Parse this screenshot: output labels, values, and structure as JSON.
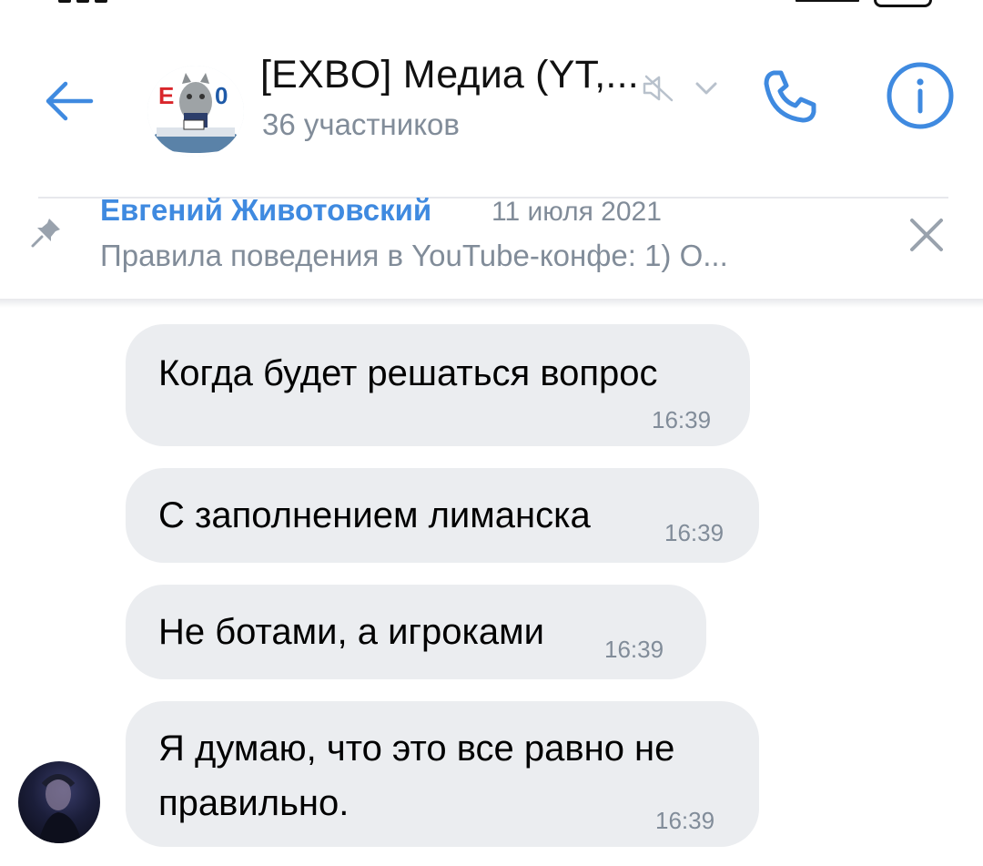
{
  "chat": {
    "title": "[EXBO] Медиа (YT,...",
    "members": "36 участников",
    "avatar_logo_text": "EXBO"
  },
  "pinned": {
    "author": "Евгений Животовский",
    "date": "11 июля 2021",
    "text": "Правила поведения в YouTube-конфе:  1) О..."
  },
  "messages": [
    {
      "text": "Когда будет решаться вопрос",
      "time": "16:39"
    },
    {
      "text": "С заполнением лиманска",
      "time": "16:39"
    },
    {
      "text": "Не ботами, а игроками",
      "time": "16:39"
    },
    {
      "text_line1": "Я думаю, что это все равно не",
      "text_line2": "правильно.",
      "time": "16:39"
    }
  ],
  "icons": {
    "back": "arrow-left-icon",
    "mute": "muted-speaker-icon",
    "dropdown": "chevron-down-icon",
    "call": "phone-icon",
    "info": "info-icon",
    "pin": "pin-icon",
    "close": "close-icon"
  },
  "colors": {
    "accent": "#3f8ae0",
    "secondary_text": "#818c99",
    "bubble": "#ebedf0"
  }
}
